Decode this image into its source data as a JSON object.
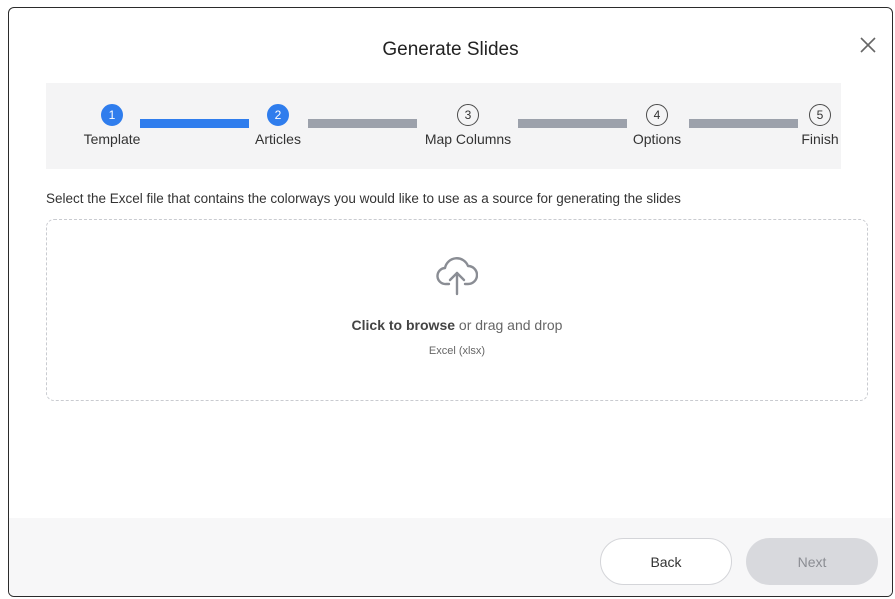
{
  "dialog": {
    "title": "Generate Slides"
  },
  "stepper": {
    "steps": [
      {
        "number": "1",
        "label": "Template",
        "state": "done"
      },
      {
        "number": "2",
        "label": "Articles",
        "state": "done"
      },
      {
        "number": "3",
        "label": "Map Columns",
        "state": "pending"
      },
      {
        "number": "4",
        "label": "Options",
        "state": "pending"
      },
      {
        "number": "5",
        "label": "Finish",
        "state": "pending"
      }
    ]
  },
  "instruction": "Select the Excel file that contains the colorways you would like to use as a source for generating the slides",
  "dropzone": {
    "icon": "cloud-upload-icon",
    "browse_label": "Click to browse",
    "drag_text": "or drag and drop",
    "file_types": "Excel (xlsx)"
  },
  "footer": {
    "back_label": "Back",
    "next_label": "Next"
  },
  "colors": {
    "accent": "#2f7ded",
    "inactive": "#9ca1ab"
  }
}
